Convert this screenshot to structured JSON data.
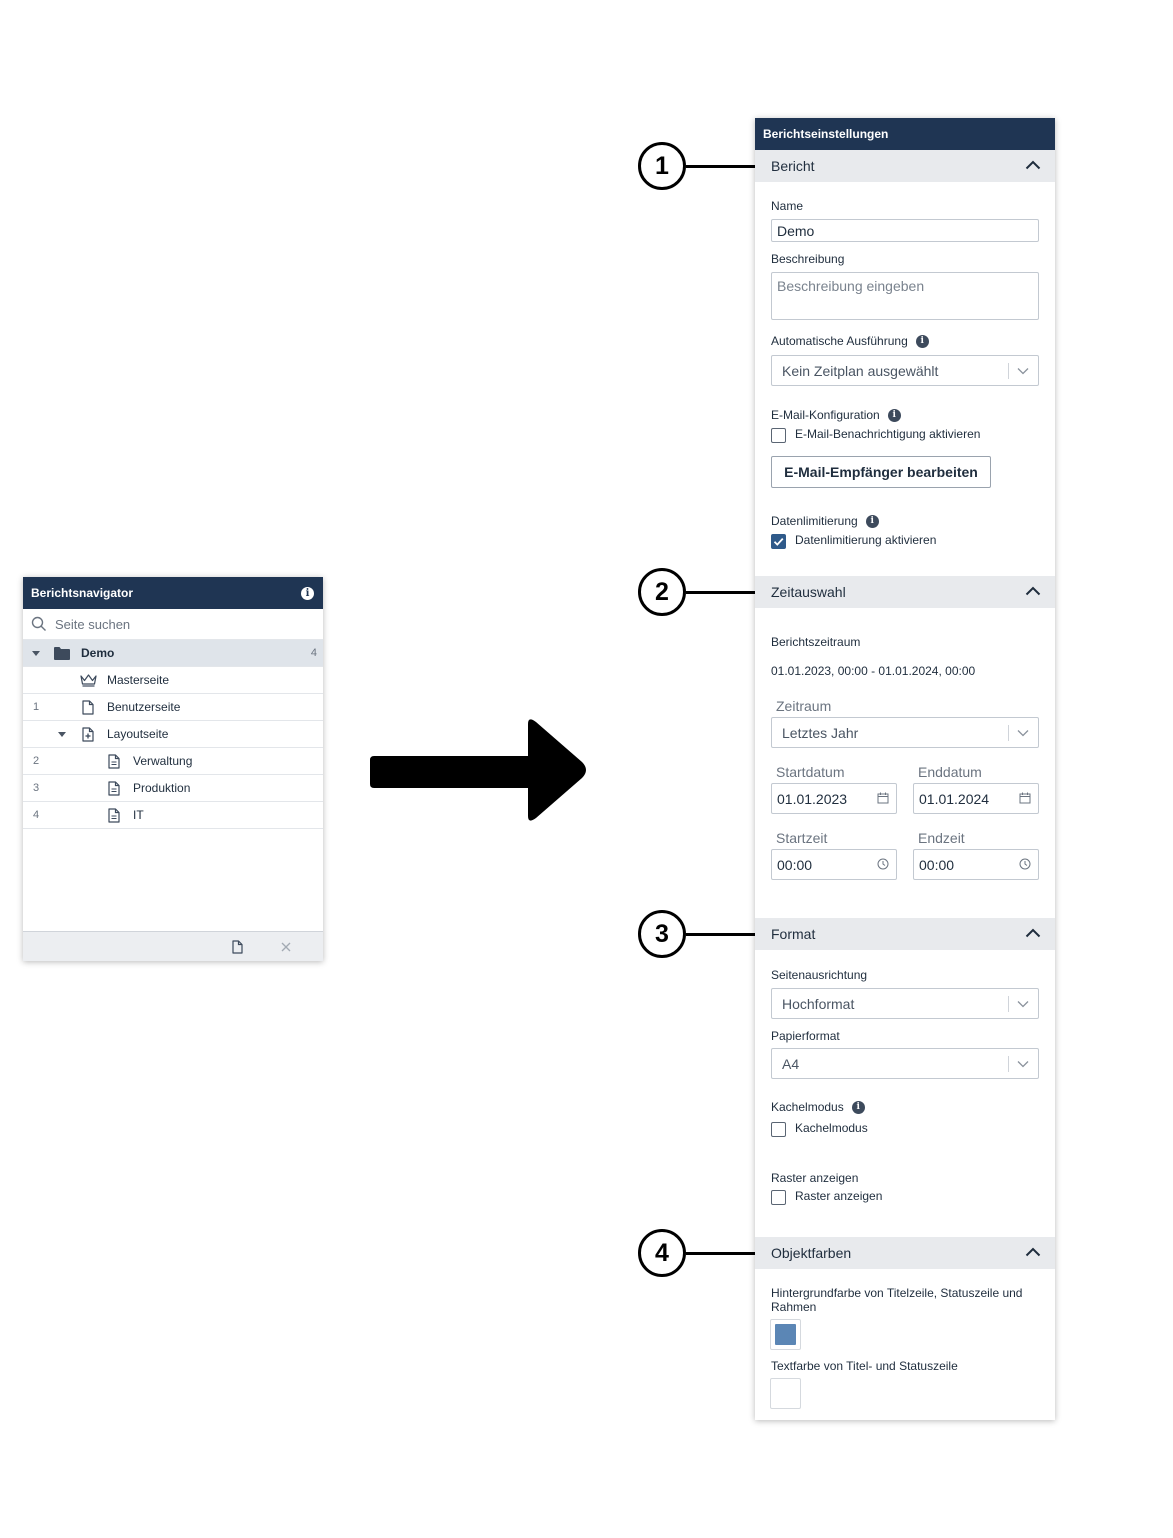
{
  "navigator": {
    "title": "Berichtsnavigator",
    "search_placeholder": "Seite suchen",
    "root": {
      "label": "Demo",
      "count": "4"
    },
    "items": [
      {
        "num": "",
        "label": "Masterseite",
        "icon": "crown-icon"
      },
      {
        "num": "1",
        "label": "Benutzerseite",
        "icon": "page-icon"
      },
      {
        "num": "",
        "label": "Layoutseite",
        "icon": "layout-page-icon"
      },
      {
        "num": "2",
        "label": "Verwaltung",
        "icon": "document-icon"
      },
      {
        "num": "3",
        "label": "Produktion",
        "icon": "document-icon"
      },
      {
        "num": "4",
        "label": "IT",
        "icon": "document-icon"
      }
    ]
  },
  "settings": {
    "title": "Berichtseinstellungen",
    "sections": {
      "bericht": {
        "title": "Bericht",
        "name_label": "Name",
        "name_value": "Demo",
        "desc_label": "Beschreibung",
        "desc_placeholder": "Beschreibung eingeben",
        "auto_label": "Automatische Ausführung",
        "auto_value": "Kein Zeitplan ausgewählt",
        "email_label": "E-Mail-Konfiguration",
        "email_checkbox": "E-Mail-Benachrichtigung aktivieren",
        "email_checked": false,
        "email_button": "E-Mail-Empfänger bearbeiten",
        "limit_label": "Datenlimitierung",
        "limit_checkbox": "Datenlimitierung aktivieren",
        "limit_checked": true
      },
      "zeitauswahl": {
        "title": "Zeitauswahl",
        "range_label": "Berichtszeitraum",
        "range_value": "01.01.2023, 00:00 - 01.01.2024, 00:00",
        "period_label": "Zeitraum",
        "period_value": "Letztes Jahr",
        "start_date_label": "Startdatum",
        "start_date": "01.01.2023",
        "end_date_label": "Enddatum",
        "end_date": "01.01.2024",
        "start_time_label": "Startzeit",
        "start_time": "00:00",
        "end_time_label": "Endzeit",
        "end_time": "00:00"
      },
      "format": {
        "title": "Format",
        "orientation_label": "Seitenausrichtung",
        "orientation_value": "Hochformat",
        "paper_label": "Papierformat",
        "paper_value": "A4",
        "tile_label": "Kachelmodus",
        "tile_checkbox": "Kachelmodus",
        "tile_checked": false,
        "grid_label": "Raster anzeigen",
        "grid_checkbox": "Raster anzeigen",
        "grid_checked": false
      },
      "objektfarben": {
        "title": "Objektfarben",
        "bg_label": "Hintergrundfarbe von Titelzeile, Statuszeile und Rahmen",
        "bg_color": "#5b86b5",
        "text_label": "Textfarbe von Titel- und Statuszeile",
        "text_color": "#ffffff"
      }
    }
  },
  "callouts": [
    "1",
    "2",
    "3",
    "4"
  ]
}
